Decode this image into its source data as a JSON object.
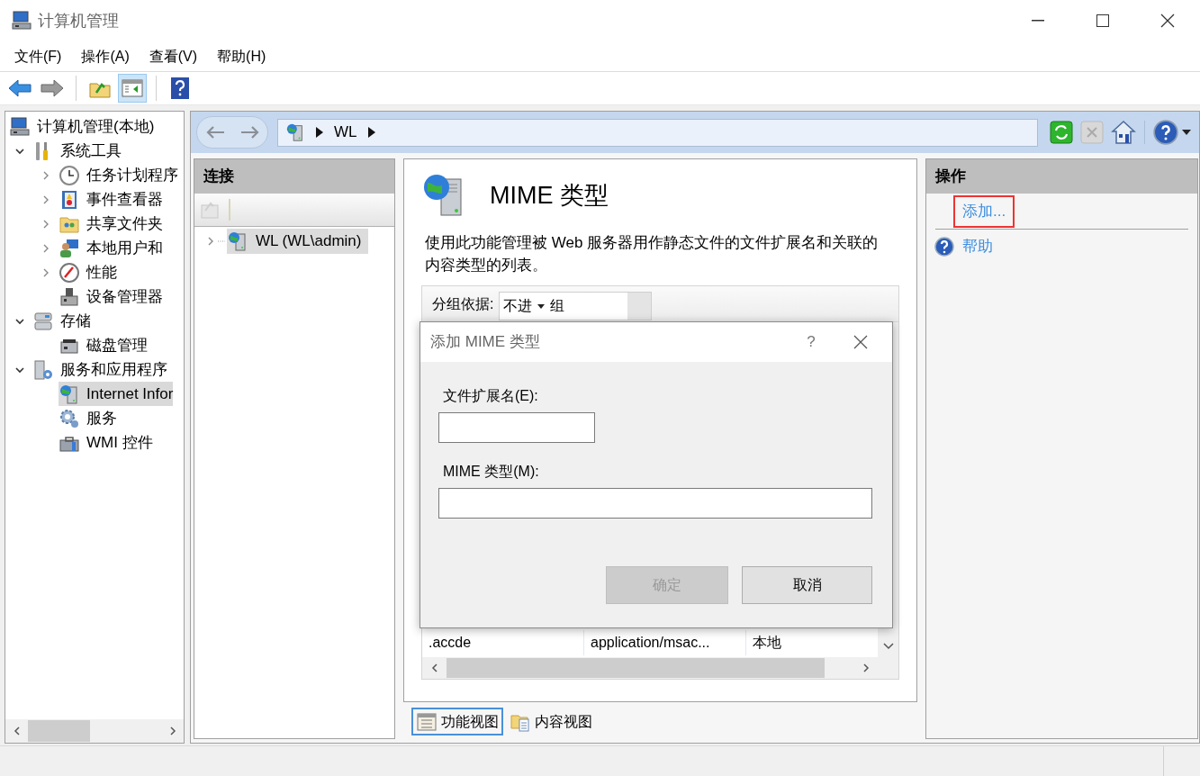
{
  "window": {
    "title": "计算机管理"
  },
  "menu": [
    "文件(F)",
    "操作(A)",
    "查看(V)",
    "帮助(H)"
  ],
  "toolbar": [
    {
      "kind": "back",
      "disabled": false,
      "pressed": false
    },
    {
      "kind": "forward",
      "disabled": true,
      "pressed": false
    },
    {
      "kind": "up",
      "disabled": false,
      "pressed": false
    },
    {
      "kind": "console",
      "disabled": false,
      "pressed": true
    },
    {
      "kind": "help",
      "disabled": false,
      "pressed": false
    }
  ],
  "tree": [
    {
      "label": "计算机管理(本地)",
      "kind": "computer",
      "selected": false,
      "children": [
        {
          "label": "系统工具",
          "kind": "tools",
          "expanded": true,
          "selected": false,
          "children": [
            {
              "label": "任务计划程序",
              "kind": "clock",
              "expanded": false,
              "selected": false
            },
            {
              "label": "事件查看器",
              "kind": "event",
              "expanded": false,
              "selected": false
            },
            {
              "label": "共享文件夹",
              "kind": "share",
              "expanded": false,
              "selected": false
            },
            {
              "label": "本地用户和",
              "kind": "users",
              "expanded": false,
              "selected": false
            },
            {
              "label": "性能",
              "kind": "perf",
              "expanded": false,
              "selected": false
            },
            {
              "label": "设备管理器",
              "kind": "device",
              "selected": false
            }
          ]
        },
        {
          "label": "存储",
          "kind": "storage",
          "expanded": true,
          "selected": false,
          "children": [
            {
              "label": "磁盘管理",
              "kind": "disk",
              "selected": false
            }
          ]
        },
        {
          "label": "服务和应用程序",
          "kind": "services",
          "expanded": true,
          "selected": false,
          "children": [
            {
              "label": "Internet Infor",
              "kind": "iis",
              "selected": true
            },
            {
              "label": "服务",
              "kind": "gear",
              "selected": false
            },
            {
              "label": "WMI 控件",
              "kind": "wmi",
              "selected": false
            }
          ]
        }
      ]
    }
  ],
  "nav": {
    "back_disabled": true,
    "forward_disabled": true,
    "path": [
      "WL"
    ],
    "tools": [
      {
        "kind": "refresh",
        "disabled": false,
        "dropdown": false
      },
      {
        "kind": "stop",
        "disabled": true,
        "dropdown": false
      },
      {
        "kind": "home",
        "disabled": false,
        "dropdown": false
      },
      {
        "kind": "help",
        "disabled": false,
        "dropdown": true
      }
    ]
  },
  "connections": {
    "title": "连接",
    "items": [
      {
        "label": "WL (WL\\admin)",
        "expanded": false,
        "selected": true
      }
    ]
  },
  "feature": {
    "title": "MIME 类型",
    "description": "使用此功能管理被 Web 服务器用作静态文件的文件扩展名和关联的内容类型的列表。",
    "group_label": "分组依据:",
    "group_value_parts": [
      "不进",
      "组"
    ],
    "rows": [
      [
        ".accde",
        "application/msac...",
        "本地"
      ]
    ]
  },
  "view_tabs": [
    {
      "label": "功能视图",
      "kind": "features",
      "selected": true
    },
    {
      "label": "内容视图",
      "kind": "content",
      "selected": false
    }
  ],
  "actions": {
    "title": "操作",
    "items": [
      {
        "label": "添加...",
        "kind": "link",
        "highlighted": true
      },
      {
        "label": "帮助",
        "kind": "help",
        "highlighted": false
      }
    ]
  },
  "dialog": {
    "title": "添加 MIME 类型",
    "help": "?",
    "fields": [
      {
        "label": "文件扩展名(E):",
        "kind": "short"
      },
      {
        "label": "MIME 类型(M):",
        "kind": "long"
      }
    ],
    "buttons": [
      {
        "label": "确定",
        "disabled": true
      },
      {
        "label": "取消",
        "disabled": false
      }
    ]
  }
}
